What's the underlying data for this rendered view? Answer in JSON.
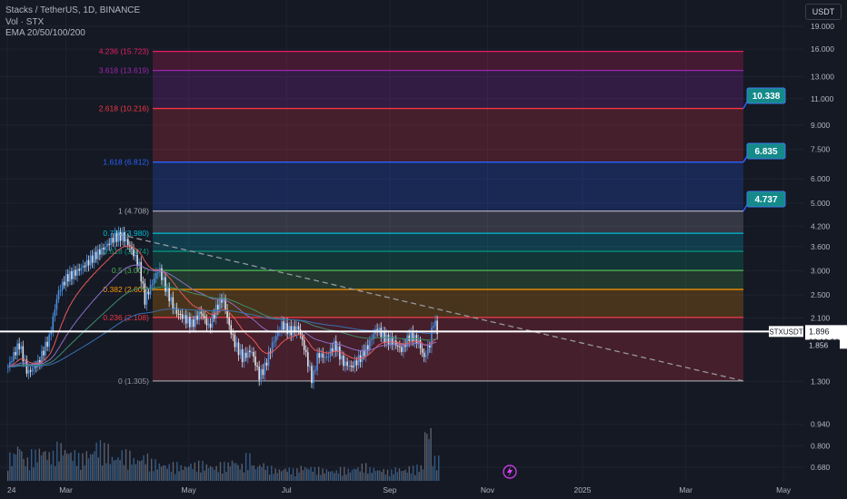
{
  "header": {
    "title": "Stacks / TetherUS, 1D, BINANCE",
    "volume": "Vol · STX",
    "ema": "EMA 20/50/100/200"
  },
  "currency_button": "USDT",
  "colors": {
    "background": "#151924",
    "up_candle": "#4a90e2",
    "down_candle": "#e0e3eb",
    "ema20": "#e45a5a",
    "ema50": "#8b6fc4",
    "ema100": "#3d8c6e",
    "ema200": "#3a6fb0",
    "label_teal": "#158a8a"
  },
  "chart_data": {
    "type": "candlestick",
    "scale": "log",
    "ylim": [
      0.62,
      20.8
    ],
    "y_ticks": [
      "19.000",
      "16.000",
      "13.000",
      "11.000",
      "9.000",
      "7.500",
      "6.000",
      "5.000",
      "4.200",
      "3.600",
      "3.000",
      "2.500",
      "2.100",
      "1.300",
      "0.940",
      "0.800",
      "0.680"
    ],
    "x_ticks": [
      "24",
      "Mar",
      "May",
      "Jul",
      "Sep",
      "Nov",
      "2025",
      "Mar",
      "May"
    ],
    "fib_levels": [
      {
        "ratio": "0",
        "price": "1.305",
        "label": "0 (1.305)",
        "color": "#9598a1"
      },
      {
        "ratio": "0.236",
        "price": "2.108",
        "label": "0.236 (2.108)",
        "color": "#f23645"
      },
      {
        "ratio": "0.382",
        "price": "2.605",
        "label": "0.382 (2.605)",
        "color": "#ff9800"
      },
      {
        "ratio": "0.5",
        "price": "3.007",
        "label": "0.5 (3.007)",
        "color": "#4caf50"
      },
      {
        "ratio": "0.618",
        "price": "3.474",
        "label": "0.618 (3.474)",
        "color": "#089981"
      },
      {
        "ratio": "0.786",
        "price": "3.980",
        "label": "0.786 (3.980)",
        "color": "#00bcd4"
      },
      {
        "ratio": "1",
        "price": "4.708",
        "label": "1 (4.708)",
        "color": "#a8a8b4"
      },
      {
        "ratio": "1.618",
        "price": "6.812",
        "label": "1.618 (6.812)",
        "color": "#2962ff"
      },
      {
        "ratio": "2.618",
        "price": "10.216",
        "label": "2.618 (10.216)",
        "color": "#f23645"
      },
      {
        "ratio": "3.618",
        "price": "13.619",
        "label": "3.618 (13.619)",
        "color": "#9c27b0"
      },
      {
        "ratio": "4.236",
        "price": "15.723",
        "label": "4.236 (15.723)",
        "color": "#e91e63"
      }
    ],
    "targets": [
      "10.338",
      "6.835",
      "4.737"
    ],
    "last_price": {
      "symbol": "STXUSDT",
      "price": "1.896",
      "countdown": "02:16:36",
      "ref_price": "1.856"
    },
    "trendline": {
      "from": [
        2.0,
        3.95
      ],
      "to": [
        7.65,
        1.305
      ]
    },
    "price_path_month_index": [
      [
        0.0,
        1.45
      ],
      [
        0.2,
        1.72
      ],
      [
        0.35,
        1.38
      ],
      [
        0.55,
        1.5
      ],
      [
        0.75,
        1.82
      ],
      [
        0.9,
        2.55
      ],
      [
        1.05,
        2.85
      ],
      [
        1.2,
        2.95
      ],
      [
        1.35,
        3.1
      ],
      [
        1.55,
        3.35
      ],
      [
        1.75,
        3.6
      ],
      [
        1.9,
        3.85
      ],
      [
        2.05,
        3.9
      ],
      [
        2.2,
        3.55
      ],
      [
        2.35,
        3.1
      ],
      [
        2.45,
        2.4
      ],
      [
        2.55,
        2.65
      ],
      [
        2.7,
        3.05
      ],
      [
        2.85,
        2.55
      ],
      [
        3.0,
        2.2
      ],
      [
        3.15,
        2.1
      ],
      [
        3.3,
        2.0
      ],
      [
        3.45,
        2.2
      ],
      [
        3.6,
        1.95
      ],
      [
        3.75,
        2.3
      ],
      [
        3.85,
        2.45
      ],
      [
        3.95,
        2.0
      ],
      [
        4.05,
        1.75
      ],
      [
        4.2,
        1.55
      ],
      [
        4.35,
        1.65
      ],
      [
        4.5,
        1.35
      ],
      [
        4.6,
        1.45
      ],
      [
        4.75,
        1.75
      ],
      [
        4.9,
        2.0
      ],
      [
        5.05,
        1.9
      ],
      [
        5.2,
        1.95
      ],
      [
        5.35,
        1.55
      ],
      [
        5.45,
        1.3
      ],
      [
        5.55,
        1.6
      ],
      [
        5.7,
        1.55
      ],
      [
        5.85,
        1.72
      ],
      [
        6.0,
        1.5
      ],
      [
        6.15,
        1.45
      ],
      [
        6.3,
        1.55
      ],
      [
        6.45,
        1.7
      ],
      [
        6.6,
        1.95
      ],
      [
        6.75,
        1.8
      ],
      [
        6.9,
        1.75
      ],
      [
        7.05,
        1.65
      ],
      [
        7.2,
        1.85
      ],
      [
        7.35,
        1.75
      ],
      [
        7.45,
        1.55
      ],
      [
        7.55,
        1.72
      ],
      [
        7.62,
        2.05
      ],
      [
        7.7,
        1.9
      ]
    ],
    "volume_series": [
      0.45,
      0.62,
      0.38,
      0.5,
      0.55,
      0.48,
      0.62,
      0.55,
      0.5,
      0.44,
      0.5,
      0.65,
      0.6,
      0.42,
      0.5,
      0.48,
      0.38,
      0.44,
      0.35,
      0.3,
      0.28,
      0.3,
      0.26,
      0.3,
      0.32,
      0.28,
      0.25,
      0.3,
      0.36,
      0.28,
      0.44,
      0.26,
      0.3,
      0.24,
      0.2,
      0.22,
      0.2,
      0.25,
      0.24,
      0.22,
      0.2,
      0.18,
      0.22,
      0.2,
      0.24,
      0.28,
      0.22,
      0.2,
      0.18,
      0.22,
      0.2,
      0.24,
      0.26,
      0.9,
      0.4
    ]
  }
}
